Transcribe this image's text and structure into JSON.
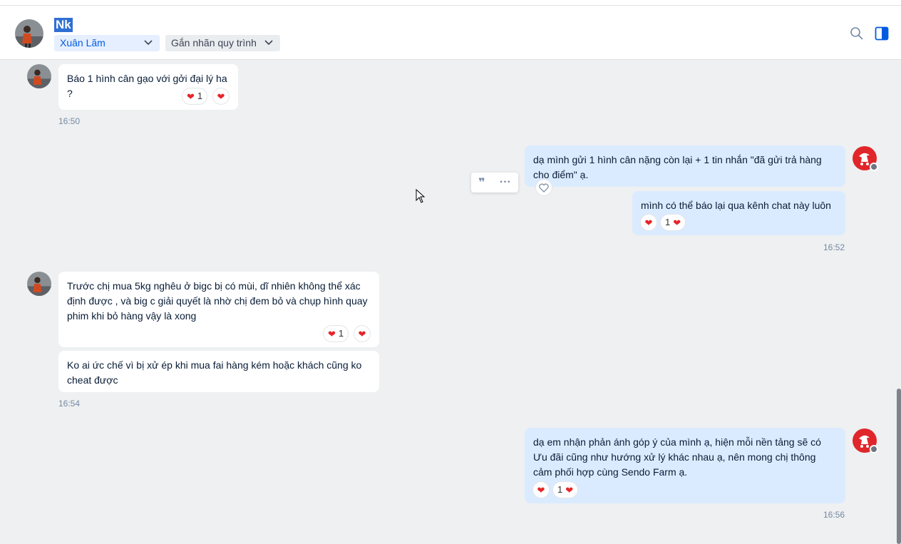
{
  "header": {
    "name": "Nk",
    "tag_label": "Xuân Lãm",
    "flow_label": "Gắn nhãn quy trình"
  },
  "messages": [
    {
      "text": "Báo 1 hình cân gạo với gởi đại lý ha ?",
      "reaction_count": "1",
      "time": "16:50"
    },
    {
      "text": "dạ mình gửi 1 hình cân nặng còn lại + 1 tin nhắn \"đã gửi trả hàng cho điểm\" ạ."
    },
    {
      "text": "mình có thể báo lại qua kênh chat này luôn ạ",
      "reaction_count": "1",
      "time": "16:52"
    },
    {
      "text": "Trước chị mua 5kg nghêu ở bigc bị có mùi, dĩ nhiên không thể xác định được , và big c giải quyết là nhờ chị đem bỏ và chụp hình quay phim khi bỏ hàng vậy là xong",
      "reaction_count": "1"
    },
    {
      "text": "Ko ai ức chế vì bị xử ép khi mua fai hàng kém hoặc khách cũng ko cheat được",
      "time": "16:54"
    },
    {
      "text": "dạ em nhận phản ánh góp ý của mình ạ, hiện mỗi nền tảng sẽ có Ưu đãi cũng như hướng xử lý khác nhau ạ, nên mong chị thông cảm phối hợp cùng Sendo Farm ạ.",
      "reaction_count": "1",
      "time": "16:56"
    }
  ],
  "icons": {
    "heart": "heart-icon",
    "quote": "quote-icon",
    "more": "more-icon",
    "search": "search-icon",
    "panel": "panel-toggle-icon"
  },
  "colors": {
    "accent": "#005ae0",
    "outgoing_bubble": "#dbebff",
    "incoming_bubble": "#ffffff",
    "heart": "#e5252a",
    "brand_avatar": "#e0262b"
  }
}
